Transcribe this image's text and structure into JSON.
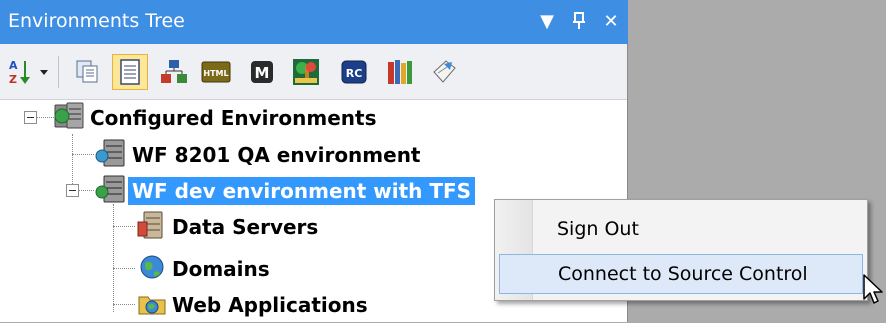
{
  "panel": {
    "title": "Environments Tree",
    "title_buttons": [
      "dropdown-icon",
      "pin-icon",
      "close-icon"
    ],
    "title_symbols": {
      "dropdown": "▼",
      "pin": "ᵖ",
      "close": "✕"
    }
  },
  "toolbar": {
    "tools": [
      {
        "name": "sort-az-icon",
        "active": false
      },
      {
        "name": "copy-pages-icon",
        "active": false
      },
      {
        "name": "document-icon",
        "active": true
      },
      {
        "name": "hierarchy-icon",
        "active": false
      },
      {
        "name": "html-icon",
        "active": false
      },
      {
        "name": "m-icon",
        "active": false
      },
      {
        "name": "tree-icon",
        "active": false
      },
      {
        "name": "rc-icon",
        "active": false
      },
      {
        "name": "books-icon",
        "active": false
      },
      {
        "name": "document-flag-icon",
        "active": false
      }
    ],
    "html_badge": "HTML",
    "m_badge": "M",
    "rc_badge": "RC",
    "sort_az_text": "A Z"
  },
  "tree": {
    "root": "Configured Environments",
    "environments": [
      {
        "label": "WF 8201 QA environment",
        "selected": false
      },
      {
        "label": "WF dev environment with TFS",
        "selected": true
      }
    ],
    "children": [
      "Data Servers",
      "Domains",
      "Web Applications"
    ]
  },
  "context_menu": {
    "items": [
      {
        "label": "Sign Out",
        "hover": false
      },
      {
        "label": "Connect to Source Control",
        "hover": true
      }
    ]
  },
  "colors": {
    "title_bar": "#3e8ee4",
    "selection": "#3399ff",
    "toolbar_bg": "#eef0f4",
    "menu_hover": "#dde9f8"
  }
}
